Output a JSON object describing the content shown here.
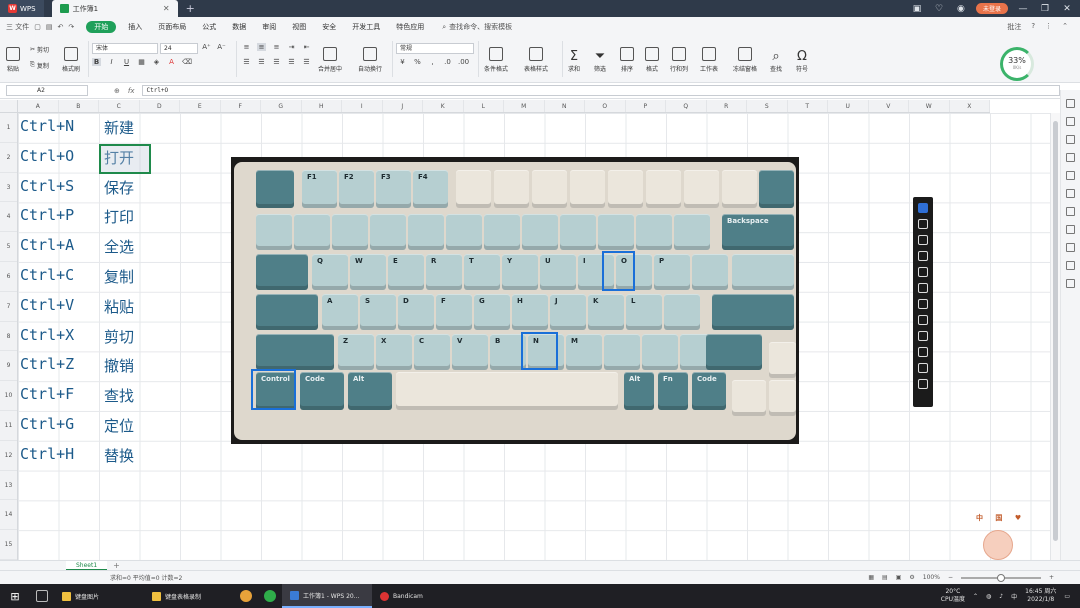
{
  "titlebar": {
    "app_name": "WPS",
    "doc_tab": "工作簿1",
    "add_tab": "+",
    "login": "未登录"
  },
  "menubar": {
    "file": "三 文件",
    "tabs": [
      "开始",
      "插入",
      "页面布局",
      "公式",
      "数据",
      "审阅",
      "视图",
      "安全",
      "开发工具",
      "特色应用"
    ],
    "active_tab": "开始",
    "search": "查找命令、搜索模板",
    "batch": "批注",
    "help": "?"
  },
  "ribbon": {
    "paste": "粘贴",
    "cut": "剪切",
    "copy": "复制",
    "format_painter": "格式刷",
    "font_name": "宋体",
    "font_size": "24",
    "merge": "合并居中",
    "wrap": "自动换行",
    "number_format": "常规",
    "cond_format": "条件格式",
    "table_style": "表格样式",
    "sum": "求和",
    "filter": "筛选",
    "sort": "排序",
    "format": "格式",
    "rowcol": "行和列",
    "worksheet": "工作表",
    "freeze": "冻结窗格",
    "find": "查找",
    "symbol": "符号",
    "cpu_pct": "33",
    "cpu_speed": "0K/s"
  },
  "formulabar": {
    "cell_ref": "A2",
    "fx": "fx",
    "formula": "Ctrl+O"
  },
  "columns": [
    "A",
    "B",
    "C",
    "D",
    "E",
    "F",
    "G",
    "H",
    "I",
    "J",
    "K",
    "L",
    "M",
    "N",
    "O",
    "P",
    "Q",
    "R",
    "S",
    "T",
    "U",
    "V",
    "W",
    "X"
  ],
  "rows": [
    "1",
    "2",
    "3",
    "4",
    "5",
    "6",
    "7",
    "8",
    "9",
    "10",
    "11",
    "12",
    "13",
    "14",
    "15"
  ],
  "shortcuts": [
    {
      "key": "Ctrl+N",
      "action": "新建"
    },
    {
      "key": "Ctrl+O",
      "action": "打开"
    },
    {
      "key": "Ctrl+S",
      "action": "保存"
    },
    {
      "key": "Ctrl+P",
      "action": "打印"
    },
    {
      "key": "Ctrl+A",
      "action": "全选"
    },
    {
      "key": "Ctrl+C",
      "action": "复制"
    },
    {
      "key": "Ctrl+V",
      "action": "粘贴"
    },
    {
      "key": "Ctrl+X",
      "action": "剪切"
    },
    {
      "key": "Ctrl+Z",
      "action": "撤销"
    },
    {
      "key": "Ctrl+F",
      "action": "查找"
    },
    {
      "key": "Ctrl+G",
      "action": "定位"
    },
    {
      "key": "Ctrl+H",
      "action": "替换"
    }
  ],
  "keyboard_labels": {
    "fn_row": [
      "F1",
      "F2",
      "F3",
      "F4"
    ],
    "backspace": "Backspace",
    "row_q": [
      "Q",
      "W",
      "E",
      "R",
      "T",
      "Y",
      "U",
      "I",
      "O",
      "P"
    ],
    "row_a": [
      "A",
      "S",
      "D",
      "F",
      "G",
      "H",
      "J",
      "K",
      "L"
    ],
    "row_z": [
      "Z",
      "X",
      "C",
      "V",
      "B",
      "N",
      "M"
    ],
    "control": "Control",
    "code": "Code",
    "alt": "Alt",
    "fn": "Fn"
  },
  "mascot": "中 国 ♥",
  "sheet": {
    "tab": "Sheet1",
    "add": "+"
  },
  "status": {
    "stats": "求和=0  平均值=0  计数=2",
    "zoom": "100%"
  },
  "taskbar": {
    "start": "⊞",
    "apps": [
      "键盘图片",
      "键盘表格录制",
      "工作簿1 - WPS 20...",
      "Bandicam"
    ],
    "active_app": "工作簿1 - WPS 20...",
    "weather_temp": "20°C",
    "weather_label": "CPU温度",
    "time": "16:45 周六",
    "date": "2022/1/8"
  },
  "colors": {
    "accent": "#1fa05a",
    "cell_text": "#1c5a8a",
    "highlight": "#1a6fd8"
  }
}
